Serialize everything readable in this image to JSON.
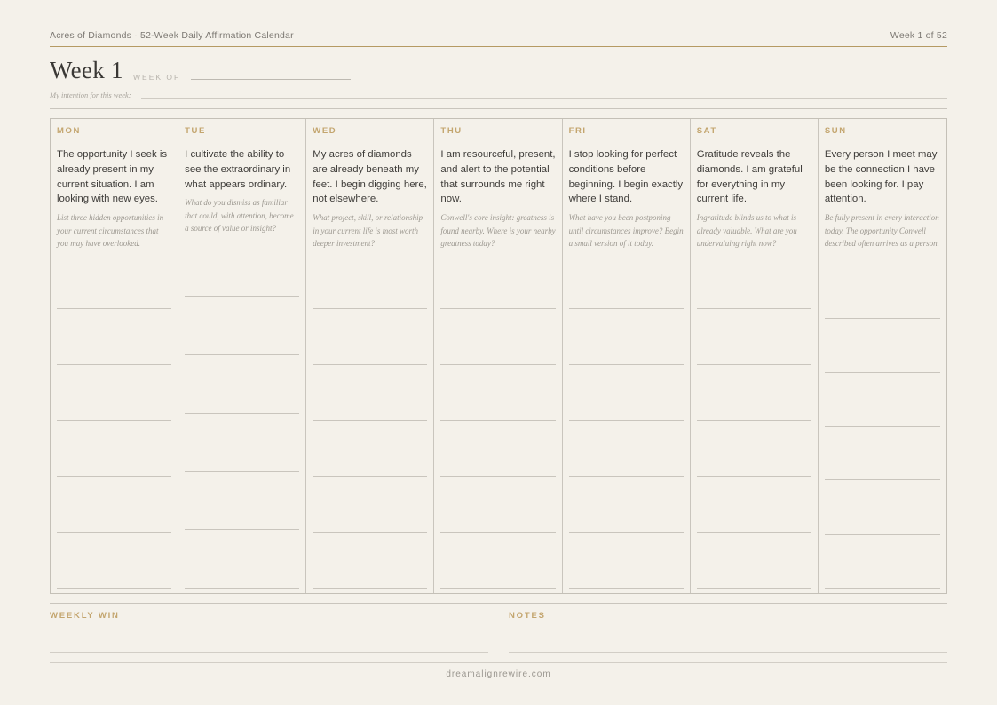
{
  "header": {
    "title": "Acres of Diamonds · 52-Week Daily Affirmation Calendar",
    "week_counter": "Week 1 of 52"
  },
  "week": {
    "title": "Week 1",
    "week_of_label": "WEEK OF",
    "intention_label": "My intention for this week:"
  },
  "days": [
    {
      "name": "MON",
      "affirmation": "The opportunity I seek is already present in my current situation. I am looking with new eyes.",
      "prompt": "List three hidden opportunities in your current circumstances that you may have overlooked."
    },
    {
      "name": "TUE",
      "affirmation": "I cultivate the ability to see the extraordinary in what appears ordinary.",
      "prompt": "What do you dismiss as familiar that could, with attention, become a source of value or insight?"
    },
    {
      "name": "WED",
      "affirmation": "My acres of diamonds are already beneath my feet. I begin digging here, not elsewhere.",
      "prompt": "What project, skill, or relationship in your current life is most worth deeper investment?"
    },
    {
      "name": "THU",
      "affirmation": "I am resourceful, present, and alert to the potential that surrounds me right now.",
      "prompt": "Conwell's core insight: greatness is found nearby. Where is your nearby greatness today?"
    },
    {
      "name": "FRI",
      "affirmation": "I stop looking for perfect conditions before beginning. I begin exactly where I stand.",
      "prompt": "What have you been postponing until circumstances improve? Begin a small version of it today."
    },
    {
      "name": "SAT",
      "affirmation": "Gratitude reveals the diamonds. I am grateful for everything in my current life.",
      "prompt": "Ingratitude blinds us to what is already valuable. What are you undervaluing right now?"
    },
    {
      "name": "SUN",
      "affirmation": "Every person I meet may be the connection I have been looking for. I pay attention.",
      "prompt": "Be fully present in every interaction today. The opportunity Conwell described often arrives as a person."
    }
  ],
  "bottom": {
    "weekly_win_label": "WEEKLY WIN",
    "notes_label": "NOTES"
  },
  "footer": {
    "site": "dreamalignrewire.com"
  },
  "colors": {
    "background": "#f4f1ea",
    "accent_gold": "#c3a56e",
    "text": "#3e3c39"
  }
}
